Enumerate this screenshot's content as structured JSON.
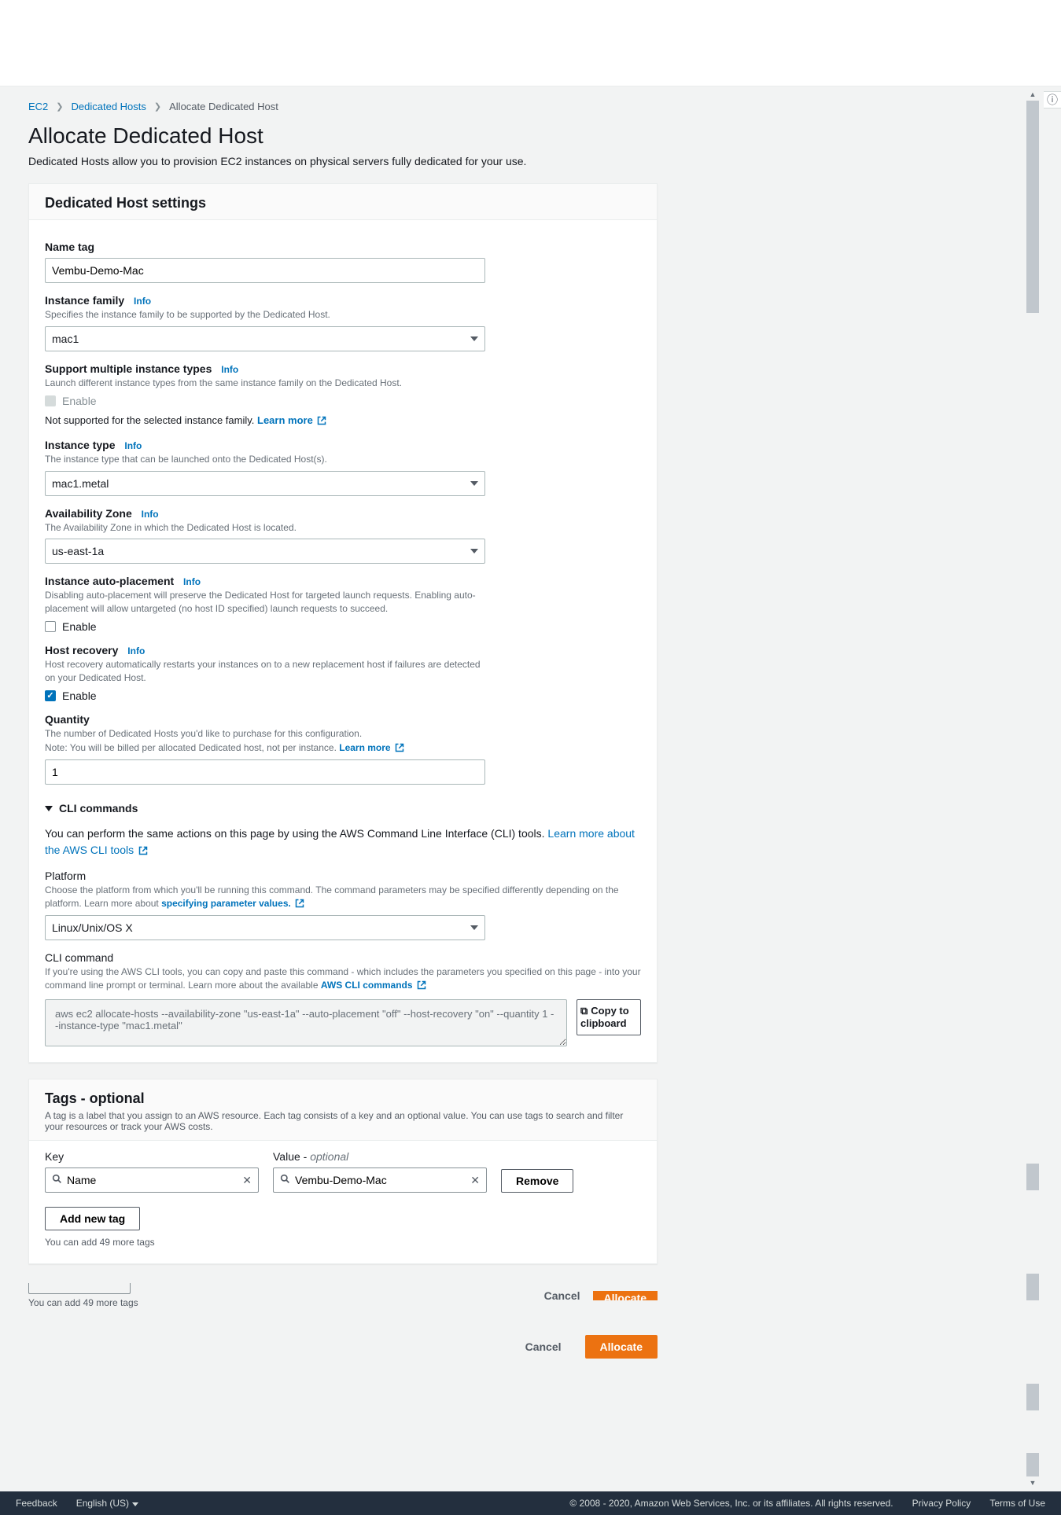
{
  "breadcrumb": {
    "ec2": "EC2",
    "hosts": "Dedicated Hosts",
    "current": "Allocate Dedicated Host"
  },
  "page": {
    "title": "Allocate Dedicated Host",
    "desc": "Dedicated Hosts allow you to provision EC2 instances on physical servers fully dedicated for your use."
  },
  "settings": {
    "header": "Dedicated Host settings",
    "nameTag": {
      "label": "Name tag",
      "value": "Vembu-Demo-Mac"
    },
    "instanceFamily": {
      "label": "Instance family",
      "info": "Info",
      "help": "Specifies the instance family to be supported by the Dedicated Host.",
      "value": "mac1"
    },
    "multiInstance": {
      "label": "Support multiple instance types",
      "info": "Info",
      "help": "Launch different instance types from the same instance family on the Dedicated Host.",
      "enable": "Enable",
      "note": "Not supported for the selected instance family.  ",
      "learn": "Learn more"
    },
    "instanceType": {
      "label": "Instance type",
      "info": "Info",
      "help": "The instance type that can be launched onto the Dedicated Host(s).",
      "value": "mac1.metal"
    },
    "az": {
      "label": "Availability Zone",
      "info": "Info",
      "help": "The Availability Zone in which the Dedicated Host is located.",
      "value": "us-east-1a"
    },
    "autoPlacement": {
      "label": "Instance auto-placement",
      "info": "Info",
      "help": "Disabling auto-placement will preserve the Dedicated Host for targeted launch requests. Enabling auto-placement will allow untargeted (no host ID specified) launch requests to succeed.",
      "enable": "Enable"
    },
    "hostRecovery": {
      "label": "Host recovery",
      "info": "Info",
      "help": "Host recovery automatically restarts your instances on to a new replacement host if failures are detected on your Dedicated Host.",
      "enable": "Enable"
    },
    "quantity": {
      "label": "Quantity",
      "help": "The number of Dedicated Hosts you'd like to purchase for this configuration.",
      "note": "Note: You will be billed per allocated Dedicated host, not per instance. ",
      "learn": "Learn more",
      "value": "1"
    },
    "cli": {
      "toggle": "CLI commands",
      "intro1": "You can perform the same actions on this page by using the AWS Command Line Interface (CLI) tools. ",
      "introLink": "Learn more about the AWS CLI tools",
      "platform": {
        "label": "Platform",
        "help1": "Choose the platform from which you'll be running this command. The command parameters may be specified differently depending on the platform. Learn more about ",
        "helpLink": "specifying parameter values.",
        "value": "Linux/Unix/OS X"
      },
      "command": {
        "label": "CLI command",
        "help1": "If you're using the AWS CLI tools, you can copy and paste this command - which includes the parameters you specified on this page - into your command line prompt or terminal. Learn more about the available ",
        "helpLink": "AWS CLI commands",
        "value": "aws ec2 allocate-hosts --availability-zone \"us-east-1a\" --auto-placement \"off\" --host-recovery \"on\" --quantity 1 --instance-type \"mac1.metal\"",
        "copy": "Copy to clipboard"
      }
    }
  },
  "tags": {
    "header": "Tags - optional",
    "desc": "A tag is a label that you assign to an AWS resource. Each tag consists of a key and an optional value. You can use tags to search and filter your resources or track your AWS costs.",
    "keyLabel": "Key",
    "valueLabel": "Value - ",
    "valueOptional": "optional",
    "keyValue": "Name",
    "valueValue": "Vembu-Demo-Mac",
    "remove": "Remove",
    "addTag": "Add new tag",
    "moreNote": "You can add 49 more tags"
  },
  "cutoff": {
    "note": "You can add 49 more tags",
    "cancel": "Cancel",
    "allocate": "Allocate"
  },
  "actions": {
    "cancel": "Cancel",
    "allocate": "Allocate"
  },
  "footer": {
    "feedback": "Feedback",
    "language": "English (US)",
    "copyright": "© 2008 - 2020, Amazon Web Services, Inc. or its affiliates. All rights reserved.",
    "privacy": "Privacy Policy",
    "terms": "Terms of Use"
  }
}
